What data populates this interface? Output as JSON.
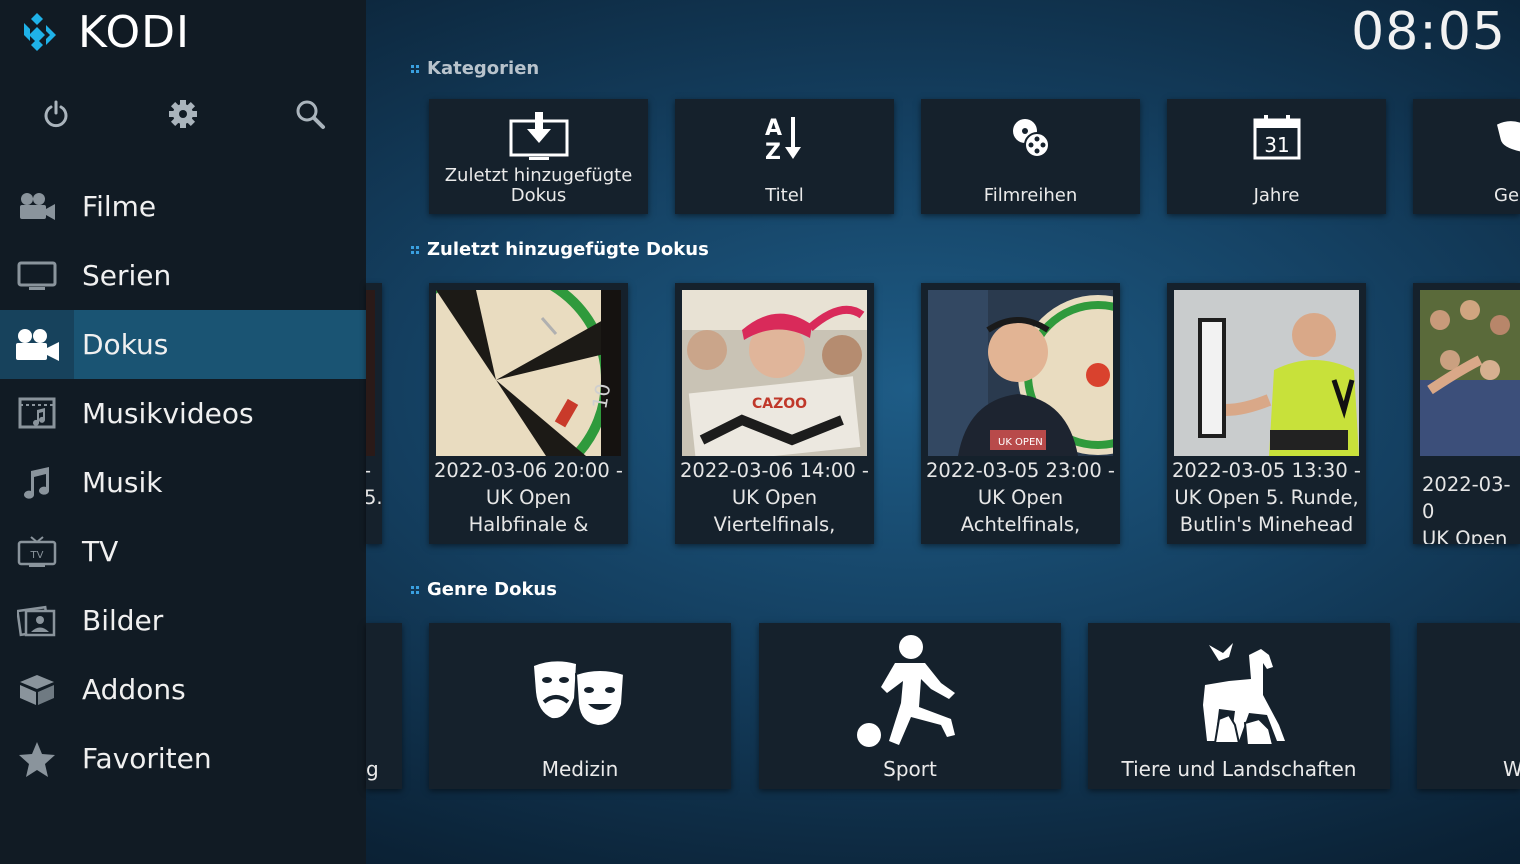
{
  "app": {
    "logo_text": "KODI",
    "clock": "08:05"
  },
  "top_icons": [
    "power-icon",
    "gear-icon",
    "search-icon"
  ],
  "menu": [
    {
      "label": "Filme",
      "icon": "film-camera-icon"
    },
    {
      "label": "Serien",
      "icon": "tv-monitor-icon"
    },
    {
      "label": "Dokus",
      "icon": "video-camera-icon",
      "active": true
    },
    {
      "label": "Musikvideos",
      "icon": "music-video-icon"
    },
    {
      "label": "Musik",
      "icon": "music-note-icon"
    },
    {
      "label": "TV",
      "icon": "tv-icon"
    },
    {
      "label": "Bilder",
      "icon": "pictures-icon"
    },
    {
      "label": "Addons",
      "icon": "addons-box-icon"
    },
    {
      "label": "Favoriten",
      "icon": "star-icon"
    }
  ],
  "sections": {
    "categories": "Kategorien",
    "recent": "Zuletzt hinzugefügte Dokus",
    "genres": "Genre Dokus"
  },
  "categories": [
    {
      "label": "Zuletzt hinzugefügte\nDokus",
      "icon": "recently-added-icon"
    },
    {
      "label": "Titel",
      "icon": "sort-az-icon"
    },
    {
      "label": "Filmreihen",
      "icon": "film-reels-icon"
    },
    {
      "label": "Jahre",
      "icon": "calendar-icon",
      "calendar_day": "31"
    },
    {
      "label": "Ge",
      "icon": "genre-masks-icon"
    }
  ],
  "recent": [
    {
      "title": "-\n5."
    },
    {
      "title": "2022-03-06 20:00 -\nUK Open\nHalbfinale &"
    },
    {
      "title": "2022-03-06 14:00 -\nUK Open\nViertelfinals,"
    },
    {
      "title": "2022-03-05 23:00 -\nUK Open\nAchtelfinals,"
    },
    {
      "title": "2022-03-05 13:30 -\nUK Open 5. Runde,\nButlin's Minehead"
    },
    {
      "title": "2022-03-0\nUK Open"
    }
  ],
  "thumb_text": {
    "cazoo": "CAZOO",
    "ukopen": "UK OPEN"
  },
  "genres": [
    {
      "label": "g"
    },
    {
      "label": "Medizin",
      "icon": "theater-masks-icon"
    },
    {
      "label": "Sport",
      "icon": "soccer-player-icon"
    },
    {
      "label": "Tiere und Landschaften",
      "icon": "animals-icon"
    },
    {
      "label": "W"
    }
  ],
  "colors": {
    "accent": "#3aa0e0",
    "sidebar": "#111b24",
    "active_item": "#1a5473",
    "tile": "#15212c"
  }
}
